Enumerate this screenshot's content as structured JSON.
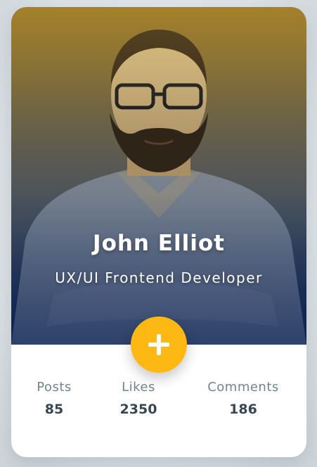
{
  "profile": {
    "name": "John Elliot",
    "role": "UX/UI Frontend Developer"
  },
  "action": {
    "icon": "plus-icon",
    "color": "#fdb813"
  },
  "stats": {
    "posts": {
      "label": "Posts",
      "value": "85"
    },
    "likes": {
      "label": "Likes",
      "value": "2350"
    },
    "comments": {
      "label": "Comments",
      "value": "186"
    }
  },
  "colors": {
    "accent": "#fdb813",
    "label": "#6f8593",
    "value": "#354656"
  }
}
